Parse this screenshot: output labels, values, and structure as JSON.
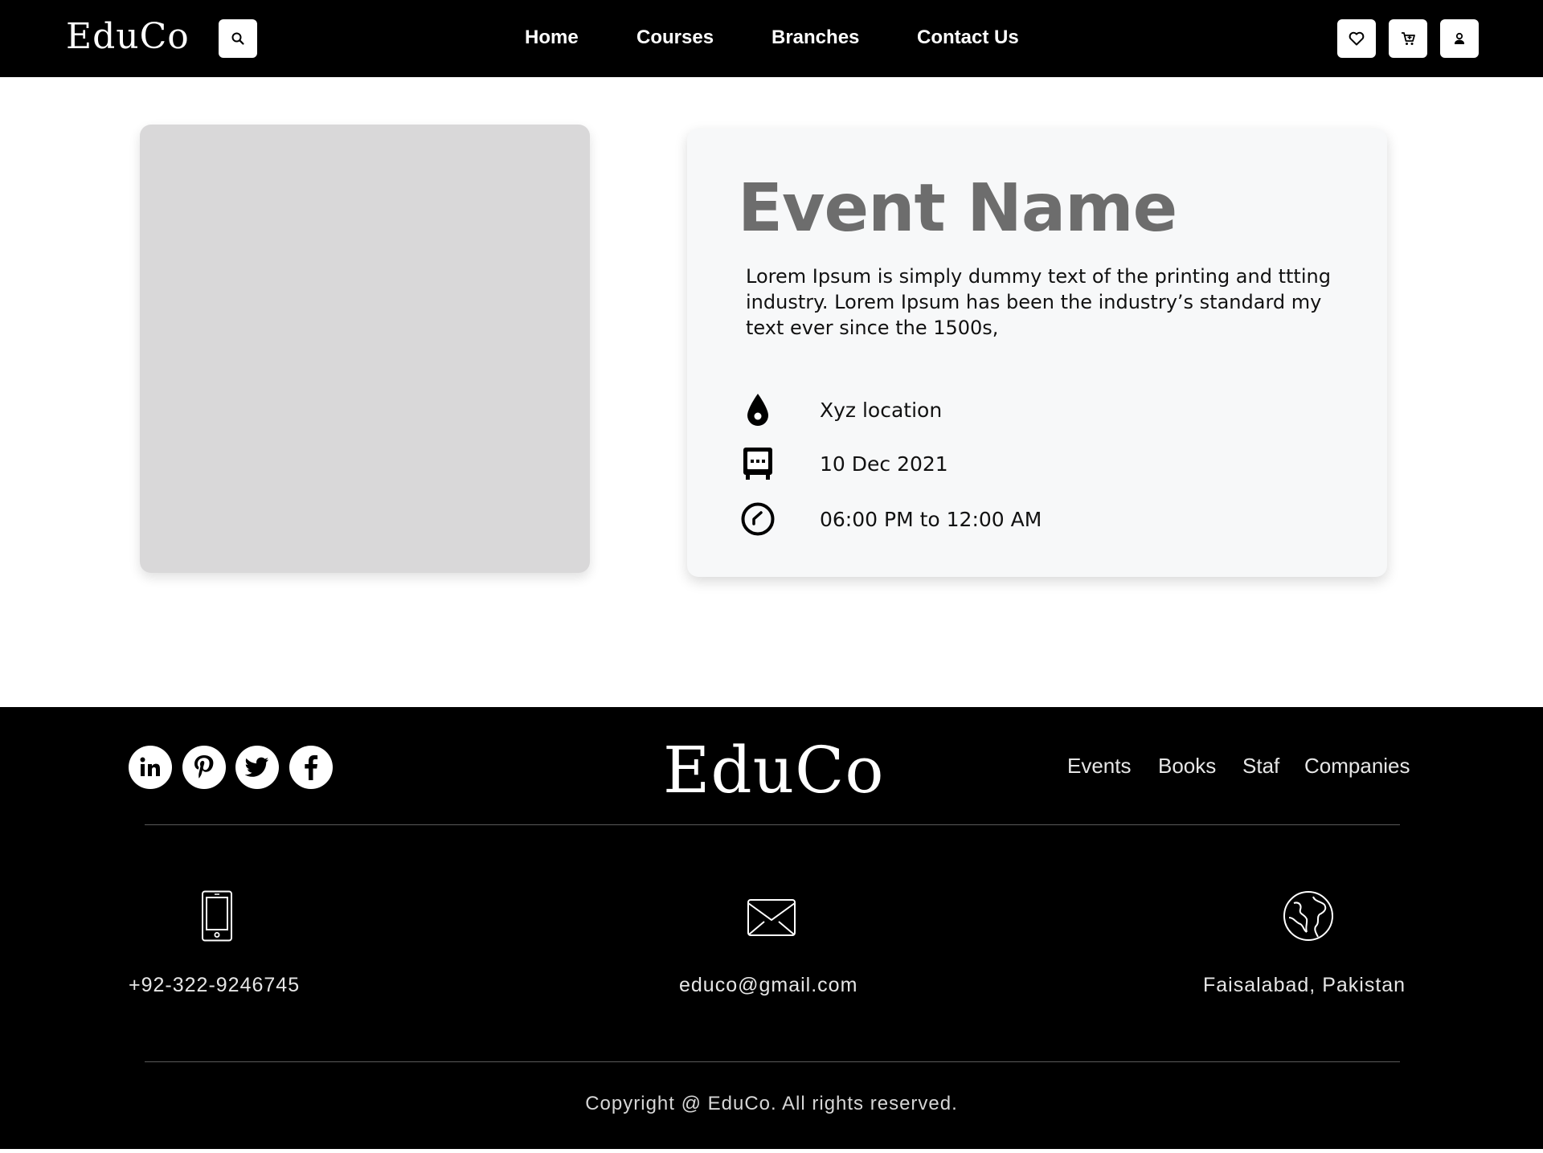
{
  "header": {
    "logo": "EduCo",
    "nav": [
      "Home",
      "Courses",
      "Branches",
      "Contact Us"
    ],
    "icons": [
      "search-icon",
      "heart-icon",
      "cart-icon",
      "user-icon"
    ]
  },
  "event": {
    "title": "Event Name",
    "description": "Lorem Ipsum is simply dummy text of the printing and ttting industry. Lorem Ipsum has been the industry’s standard my text ever since the 1500s,",
    "location": "Xyz location",
    "date": "10 Dec 2021",
    "time": "06:00 PM to 12:00 AM"
  },
  "footer": {
    "logo": "EduCo",
    "social": [
      "linkedin-icon",
      "pinterest-icon",
      "twitter-icon",
      "facebook-icon"
    ],
    "links": [
      "Events",
      "Books",
      "Staf",
      "Companies"
    ],
    "phone": "+92-322-9246745",
    "email": "educo@gmail.com",
    "address": "Faisalabad, Pakistan",
    "copyright": "Copyright @ EduCo. All rights reserved."
  },
  "colors": {
    "header_bg": "#000000",
    "footer_bg": "#000000",
    "card_bg": "#f7f8f9",
    "placeholder_bg": "#d9d8d9",
    "title_gray": "#6d6d6d"
  }
}
